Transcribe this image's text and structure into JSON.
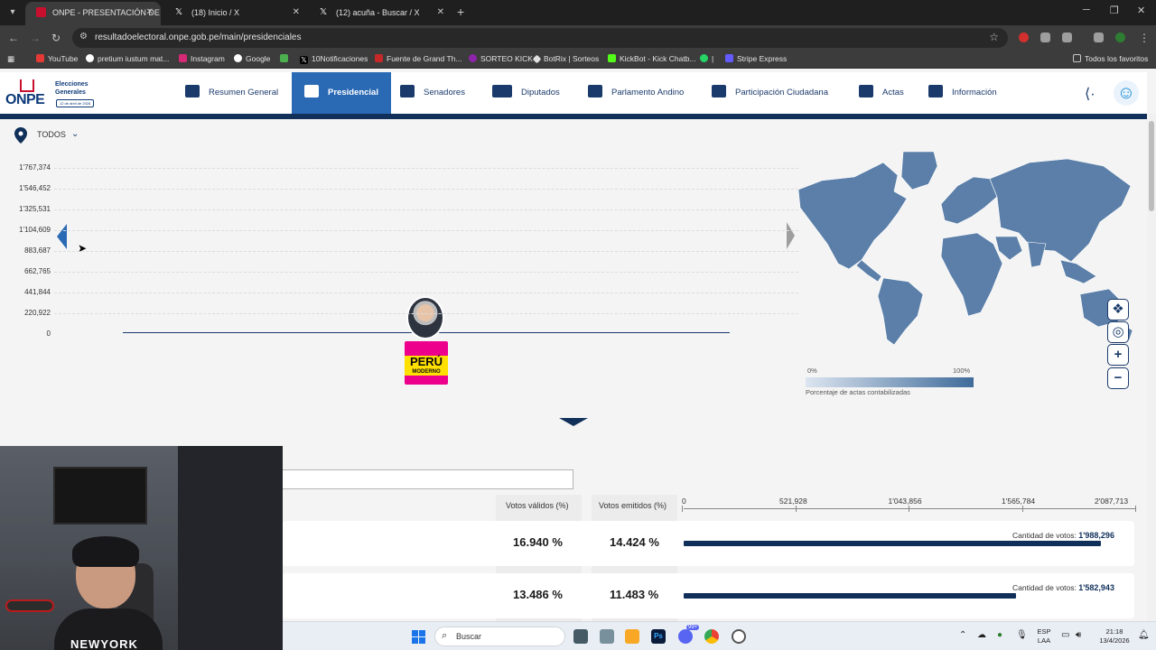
{
  "browser": {
    "tabs": [
      {
        "title": "ONPE - PRESENTACIÓN DE RE",
        "active": true
      },
      {
        "title": "(18) Inicio / X",
        "active": false
      },
      {
        "title": "(12) acuña - Buscar / X",
        "active": false
      }
    ],
    "url": "resultadoelectoral.onpe.gob.pe/main/presidenciales",
    "bookmarks": [
      "YouTube",
      "pretium iustum mat...",
      "Instagram",
      "Google",
      "10Notificaciones",
      "Fuente de Grand Th...",
      "SORTEO KICK",
      "BotRix | Sorteos",
      "KickBot - Kick Chatb...",
      "|",
      "Stripe Express"
    ],
    "all_bookmarks": "Todos los favoritos"
  },
  "site": {
    "logo_text": "ONPE",
    "logo_subtitle": "Elecciones Generales",
    "logo_date": "12 de abril de 2026",
    "menu": [
      {
        "label": "Resumen General",
        "icon": "dashboard-icon"
      },
      {
        "label": "Presidencial",
        "icon": "presidential-seal-icon",
        "active": true
      },
      {
        "label": "Senadores",
        "icon": "senate-icon"
      },
      {
        "label": "Diputados",
        "icon": "congress-icon"
      },
      {
        "label": "Parlamento Andino",
        "icon": "andean-globe-icon"
      },
      {
        "label": "Participación Ciudadana",
        "icon": "people-icon"
      },
      {
        "label": "Actas",
        "icon": "clipboard-check-icon"
      },
      {
        "label": "Información",
        "icon": "info-document-icon"
      }
    ]
  },
  "filter": {
    "location": "TODOS"
  },
  "chart_data": {
    "type": "bar",
    "title": "",
    "xlabel": "",
    "ylabel": "",
    "y_ticks": [
      "1'767,374",
      "1'546,452",
      "1'325,531",
      "1'104,609",
      "883,687",
      "662,765",
      "441,844",
      "220,922",
      "0"
    ],
    "ylim": [
      0,
      1767374
    ],
    "grid": true,
    "categories": [
      "PERÚ MODERNO"
    ],
    "values": [
      0
    ]
  },
  "party_logo": {
    "line1": "PERÚ",
    "line2": "MODERNO"
  },
  "map": {
    "legend_min": "0%",
    "legend_max": "100%",
    "legend_label": "Porcentaje de actas contabilizadas",
    "colors": {
      "low": "#dce5f0",
      "high": "#3f6b9a"
    },
    "controls": [
      "peru-map-icon",
      "globe-icon",
      "+",
      "−"
    ]
  },
  "results": {
    "headers": {
      "valid": "Votos válidos (%)",
      "emitted": "Votos emitidos (%)"
    },
    "axis": [
      "0",
      "521,928",
      "1'043,856",
      "1'565,784",
      "2'087,713"
    ],
    "axis_max": 2087713,
    "votes_label": "Cantidad de votos:",
    "rows": [
      {
        "valid_pct": "16.940 %",
        "emitted_pct": "14.424 %",
        "votes": "1'988,296",
        "votes_value": 1988296
      },
      {
        "valid_pct": "13.486 %",
        "emitted_pct": "11.483 %",
        "votes": "1'582,943",
        "votes_value": 1582943
      }
    ]
  },
  "webcam": {
    "shirt_text": "NEWYORK"
  },
  "taskbar": {
    "search": "Buscar",
    "badge_count": "99+",
    "lang_line1": "ESP",
    "lang_line2": "LAA",
    "time": "21:18",
    "date": "13/4/2026"
  },
  "colors": {
    "brand": "#1a3a6b",
    "active_tab": "#2a6ab5",
    "bar": "#10305a",
    "party": "#ec008c"
  }
}
